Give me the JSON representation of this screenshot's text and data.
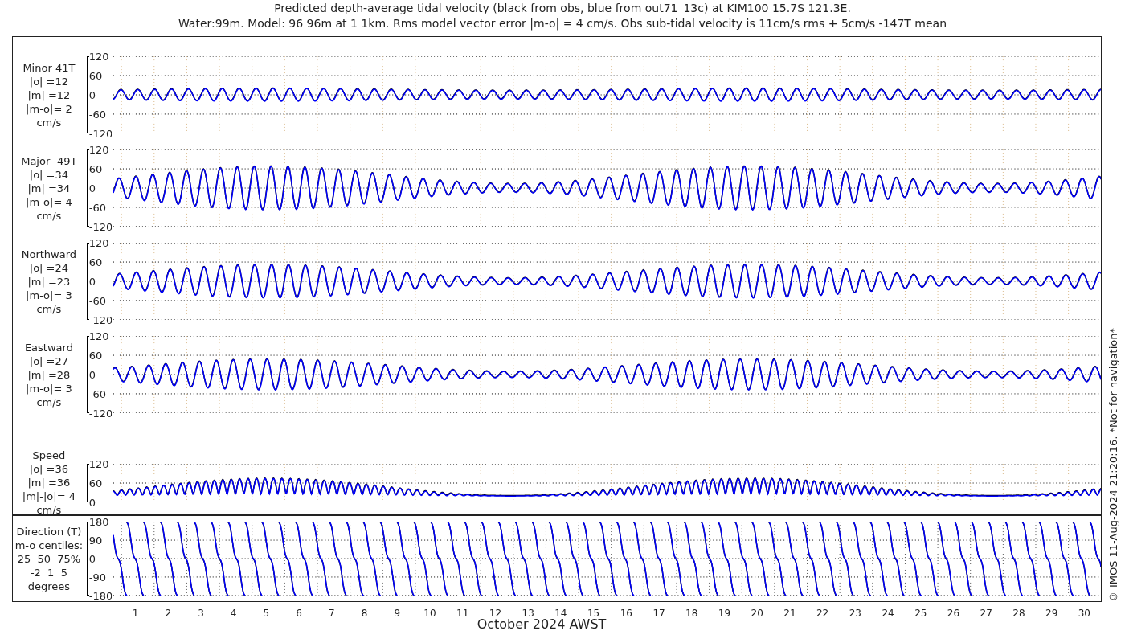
{
  "title_lines": [
    "Predicted depth-average tidal velocity (black from obs, blue from out71_13c) at KIM100 15.7S 121.3E.",
    "Water:99m. Model: 96 96m at 1 1km. Rms model vector error |m-o| = 4 cm/s. Obs sub-tidal velocity is 11cm/s rms + 5cm/s -147T mean"
  ],
  "panels": [
    {
      "kind": "signed",
      "label_lines": [
        "Minor 41T",
        "|o| =12",
        "|m| =12",
        "|m-o|= 2",
        "cm/s"
      ],
      "yticks": [
        "120",
        "60",
        "0",
        "-60",
        "-120"
      ]
    },
    {
      "kind": "signed",
      "label_lines": [
        "Major -49T",
        "|o| =34",
        "|m| =34",
        "|m-o|= 4",
        "cm/s"
      ],
      "yticks": [
        "120",
        "60",
        "0",
        "-60",
        "-120"
      ]
    },
    {
      "kind": "signed",
      "label_lines": [
        "Northward",
        "|o| =24",
        "|m| =23",
        "|m-o|= 3",
        "cm/s"
      ],
      "yticks": [
        "120",
        "60",
        "0",
        "-60",
        "-120"
      ]
    },
    {
      "kind": "signed",
      "label_lines": [
        "Eastward",
        "|o| =27",
        "|m| =28",
        "|m-o|= 3",
        "cm/s"
      ],
      "yticks": [
        "120",
        "60",
        "0",
        "-60",
        "-120"
      ]
    },
    {
      "kind": "speed",
      "label_lines": [
        "Speed",
        "|o| =36",
        "|m| =36",
        "|m|-|o|= 4",
        "cm/s"
      ],
      "yticks": [
        "120",
        "60",
        "0"
      ]
    },
    {
      "kind": "direction",
      "label_lines": [
        "Direction (T)",
        "m-o centiles:",
        "25  50  75%",
        "-2  1  5",
        "degrees"
      ],
      "yticks": [
        "180",
        "90",
        "0",
        "-90",
        "-180"
      ]
    }
  ],
  "x_axis": {
    "day_labels": [
      "1",
      "2",
      "3",
      "4",
      "5",
      "6",
      "7",
      "8",
      "9",
      "10",
      "11",
      "12",
      "13",
      "14",
      "15",
      "16",
      "17",
      "18",
      "19",
      "20",
      "21",
      "22",
      "23",
      "24",
      "25",
      "26",
      "27",
      "28",
      "29",
      "30"
    ],
    "title": "October 2024 AWST"
  },
  "credit": "© IMOS 11-Aug-2024 21:20:16. *Not for navigation*"
}
